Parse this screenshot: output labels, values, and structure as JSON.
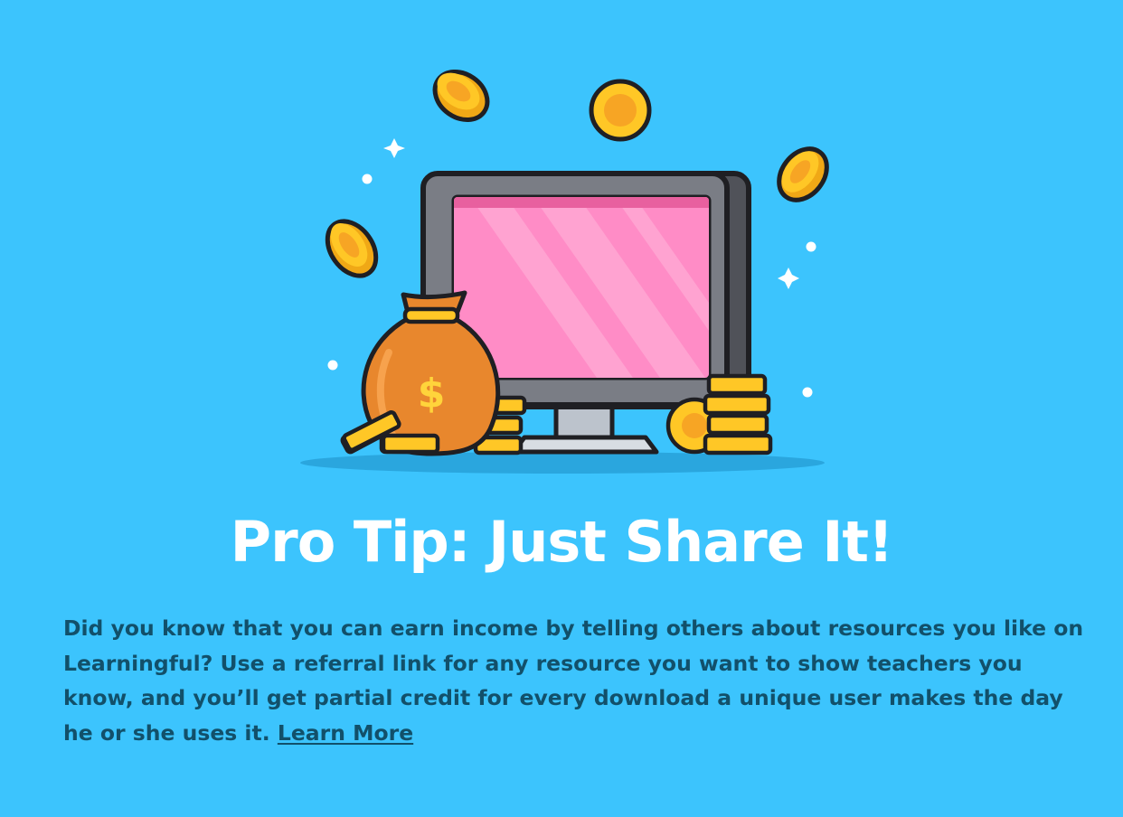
{
  "card": {
    "title": "Pro Tip: Just Share It!",
    "body": "Did you know that you can earn income by telling others about resources you like on Learningful? Use a referral link for any resource you want to show teachers you know, and you’ll get partial credit for every download a unique user makes the day he or she uses it.",
    "link_label": "Learn More"
  },
  "illustration": {
    "money_bag_symbol": "$",
    "icons": [
      "coin-icon",
      "monitor-icon",
      "money-bag-icon",
      "coin-stack-icon",
      "sparkle-icon"
    ]
  },
  "colors": {
    "background": "#3cc4fd",
    "title": "#ffffff",
    "body_text": "#12506a",
    "screen": "#ff8cc6",
    "coin": "#ffc726",
    "bag": "#e8872d"
  }
}
